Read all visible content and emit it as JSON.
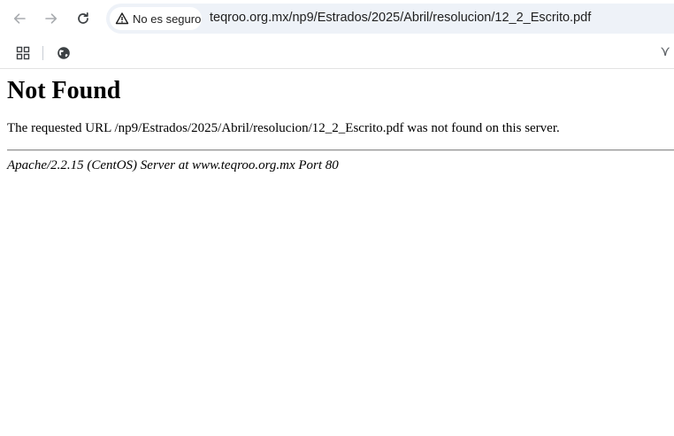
{
  "browser": {
    "security_label": "No es seguro",
    "url": "teqroo.org.mx/np9/Estrados/2025/Abril/resolucion/12_2_Escrito.pdf",
    "icons": {
      "back": "back-arrow-icon",
      "forward": "forward-arrow-icon",
      "reload": "reload-icon",
      "security": "warning-triangle-icon"
    }
  },
  "bookmarks_bar": {
    "icons": [
      "apps-grid-icon",
      "globe-icon"
    ],
    "extension_glyph": "⋎"
  },
  "page": {
    "heading": "Not Found",
    "message": "The requested URL /np9/Estrados/2025/Abril/resolucion/12_2_Escrito.pdf was not found on this server.",
    "server_signature": "Apache/2.2.15 (CentOS) Server at www.teqroo.org.mx Port 80"
  },
  "colors": {
    "omnibox_bg": "#eef2f8",
    "icon_gray": "#5f6368",
    "disabled_gray": "#a8abaf"
  }
}
